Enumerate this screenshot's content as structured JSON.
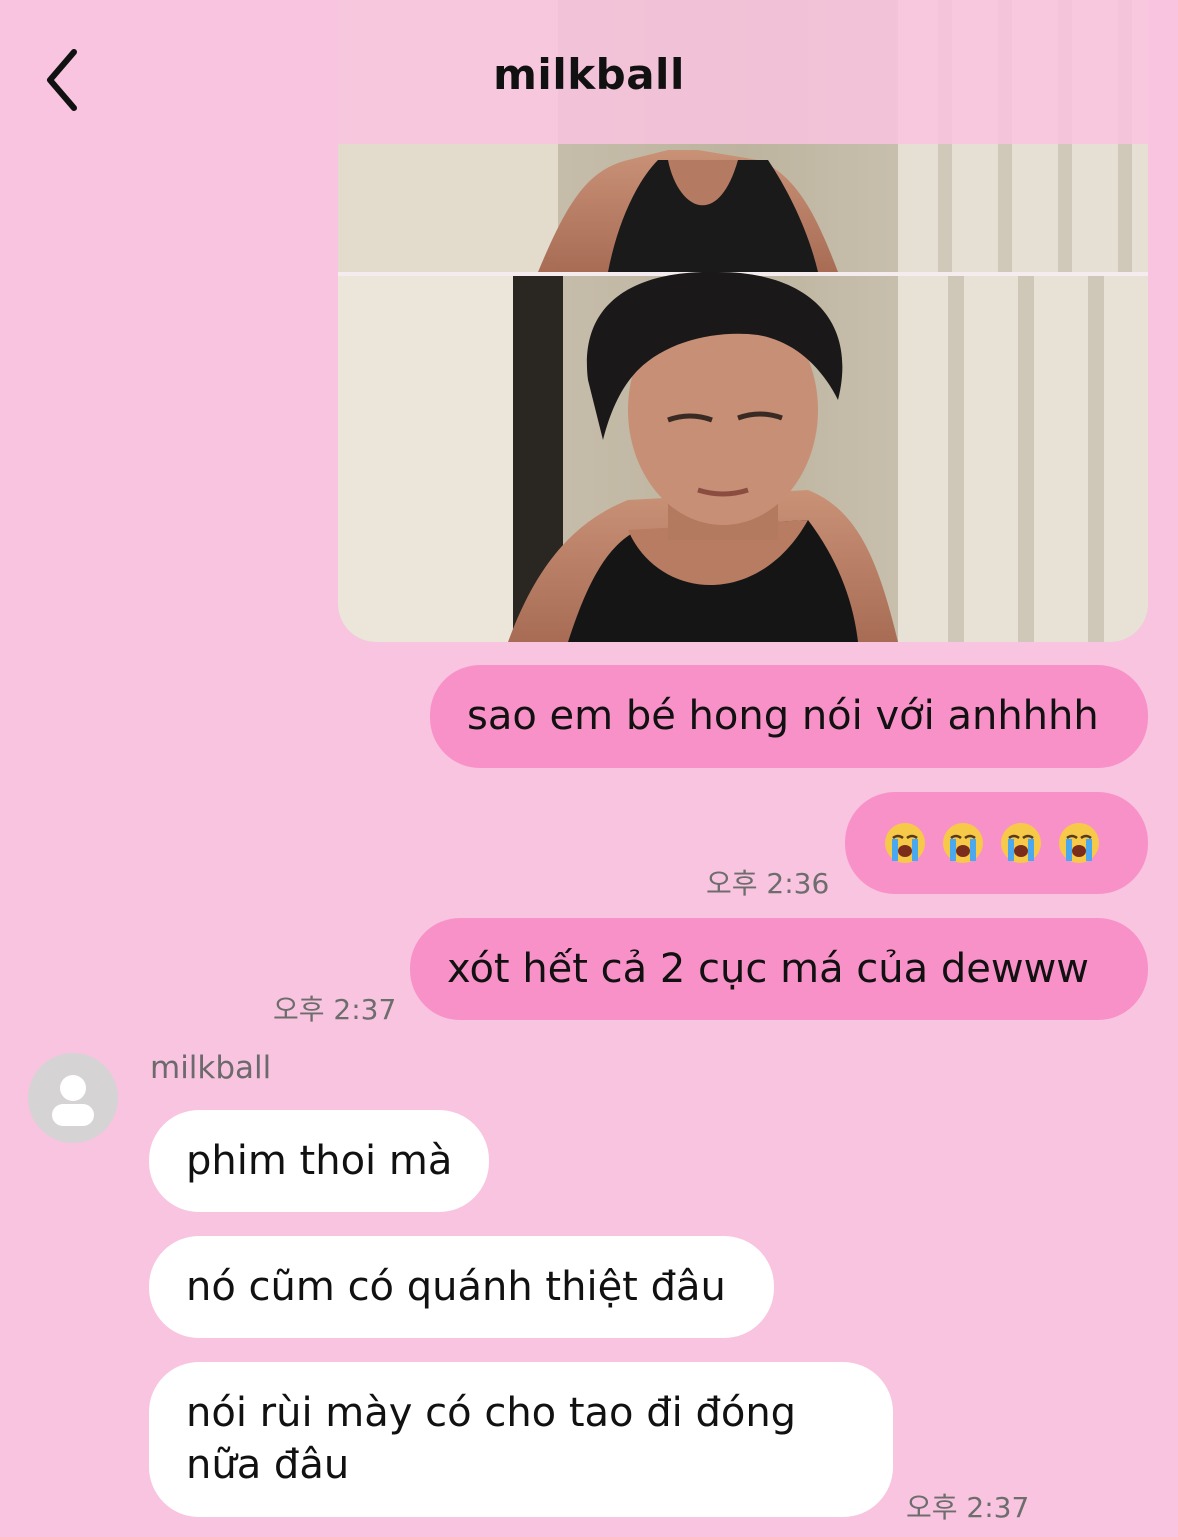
{
  "header": {
    "title": "milkball"
  },
  "messages": {
    "outgoing_1": "sao em bé hong nói với anhhhh",
    "outgoing_2_emoji_count": 4,
    "outgoing_2_time": "오후 2:36",
    "outgoing_3": "xót hết cả 2 cục má của dewww",
    "outgoing_3_time": "오후 2:37",
    "sender_name": "milkball",
    "incoming_1": "phim thoi mà",
    "incoming_2": "nó cũm có quánh thiệt đâu",
    "incoming_3_line1": "nói rùi mày có cho tao đi đóng",
    "incoming_3_line2": "nữa đâu",
    "incoming_3_time": "오후 2:37"
  },
  "colors": {
    "background": "#f9c4e0",
    "outgoing_bubble": "#f991c9",
    "incoming_bubble": "#ffffff"
  },
  "icons": {
    "back": "chevron-left-icon",
    "emoji": "loudly-crying-face-icon",
    "avatar": "default-user-icon"
  }
}
